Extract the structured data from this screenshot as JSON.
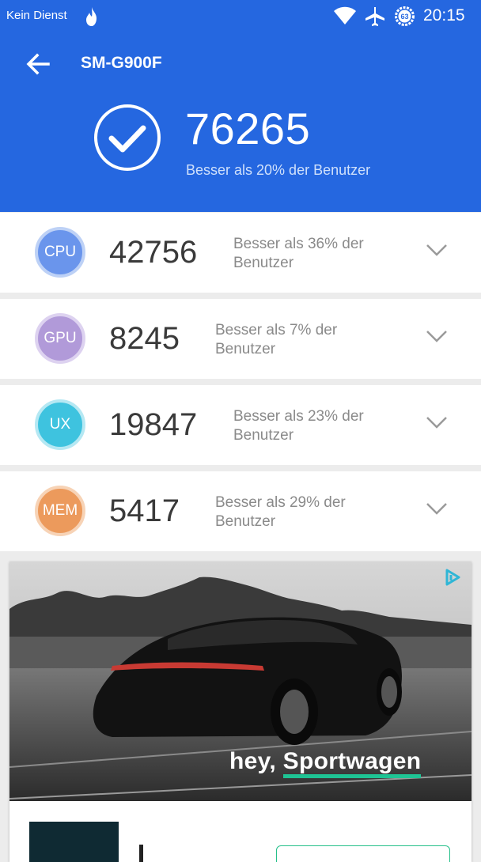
{
  "status_bar": {
    "carrier": "Kein Dienst",
    "battery_level": "63",
    "time": "20:15",
    "icons": [
      "flame-icon",
      "wifi-icon",
      "airplane-mode-icon",
      "battery-icon"
    ]
  },
  "header": {
    "title": "SM-G900F",
    "total_score": "76265",
    "total_subtitle": "Besser als 20% der Benutzer"
  },
  "scores": [
    {
      "badge": "CPU",
      "score": "42756",
      "desc": "Besser als 36% der Benutzer",
      "badge_color": "#6a95ec"
    },
    {
      "badge": "GPU",
      "score": "8245",
      "desc": "Besser als 7% der Benutzer",
      "badge_color": "#b19ad9"
    },
    {
      "badge": "UX",
      "score": "19847",
      "desc": "Besser als 23% der Benutzer",
      "badge_color": "#3ec3df"
    },
    {
      "badge": "MEM",
      "score": "5417",
      "desc": "Besser als 29% der Benutzer",
      "badge_color": "#ec9a5c"
    }
  ],
  "ad": {
    "tagline_prefix": "hey, ",
    "tagline_highlight": "Sportwagen",
    "accent_color": "#1ec494"
  },
  "colors": {
    "header_bg": "#2567e0",
    "page_bg": "#ececec"
  }
}
